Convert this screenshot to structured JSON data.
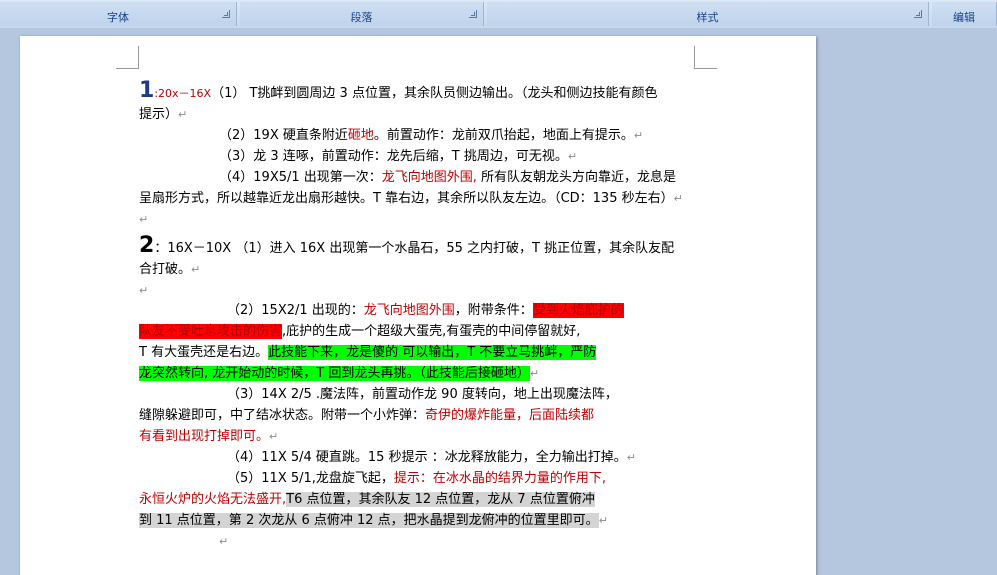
{
  "ribbon": {
    "groups": [
      {
        "label": "字体"
      },
      {
        "label": "段落"
      },
      {
        "label": "样式"
      },
      {
        "label": "编辑"
      }
    ]
  },
  "document": {
    "para_mark": "↵",
    "s1": {
      "num": "1",
      "l1_red": ":20x－16X",
      "l1_rest": "（1） T挑衅到圆周边 3 点位置，其余队员侧边输出。（龙头和侧边技能有颜色",
      "l2": "提示）",
      "l3_a": "（2）19X 硬直条附近",
      "l3_red": "砸地",
      "l3_b": "。前置动作：龙前双爪抬起，地面上有提示。",
      "l4": "（3）龙 3 连啄，前置动作：龙先后缩，T 挑周边，可无视。",
      "l5_a": "（4）19X5/1 出现第一次：",
      "l5_red": "龙飞向地图外围,",
      "l5_b": " 所有队友朝龙头方向靠近，龙息是",
      "l6": "呈扇形方式，所以越靠近龙出扇形越快。T 靠右边，其余所以队友左边。（CD：135 秒左右）"
    },
    "s2": {
      "num": "2",
      "l1": "：16X－10X （1）进入 16X 出现第一个水晶石，55 之内打破，T 挑正位置，其余队友配",
      "l2": "合打破。",
      "p2_a": "（2）15X2/1 出现的：",
      "p2_red": "龙飞向地图外围",
      "p2_b": "，附带条件：",
      "p2_hl1": "受到火焰庇护的",
      "p2_hl2": "队友不受吐息攻击的伤害",
      "p2_c": ",庇护的生成一个超级大蛋壳,有蛋壳的中间停留就好,",
      "p2_d": "T 有大蛋壳还是右边。",
      "p2_g1": "此技能下来，龙是傻的 可以输出，T 不要立马挑衅，严防",
      "p2_g2": "龙突然转向, 龙开始动的时候，T 回到龙头再挑。（此技能后接砸地）",
      "p3_a": "（3）14X 2/5 .魔法阵，前置动作龙 90 度转向，地上出现魔法阵，",
      "p3_b": "缝隙躲避即可，中了结冰状态。附带一个小炸弹：",
      "p3_red1": "奇伊的爆炸能量，后面陆续都",
      "p3_red2": "有看到出现打掉即可。",
      "p4": "（4）11X 5/4 硬直跳。15 秒提示 ：冰龙释放能力，全力输出打掉。",
      "p5_a": "（5）11X 5/1,龙盘旋飞起，",
      "p5_red": "提示：在冰水晶的结界力量的作用下,",
      "p5_red2": "永恒火炉的火焰无法盛开,",
      "p5_gray1": "T6 点位置，其余队友 12 点位置，龙从 7 点位置俯冲",
      "p5_gray2": "到 11 点位置，第 2 次龙从 6 点俯冲 12 点，把水晶提到龙俯冲的位置里即可。"
    }
  }
}
